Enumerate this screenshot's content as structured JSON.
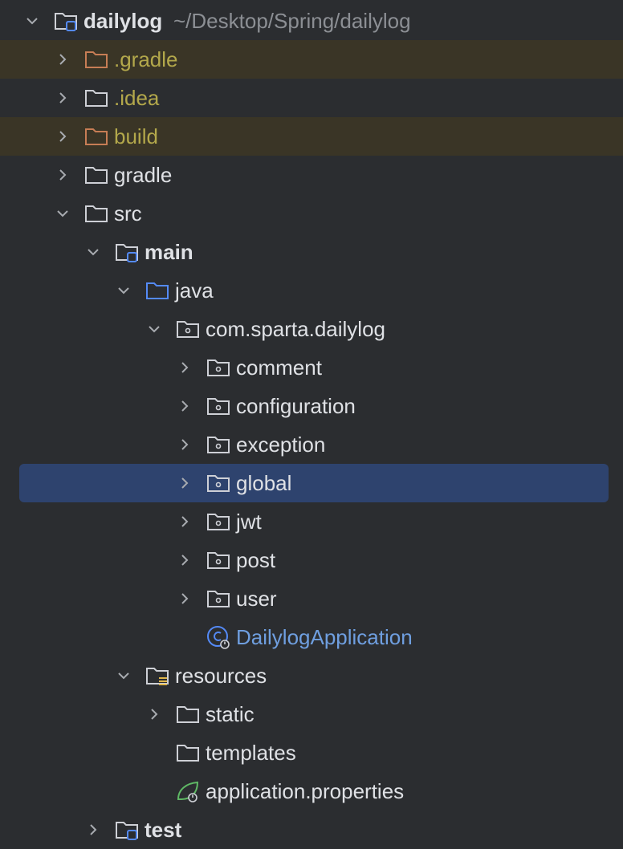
{
  "project_tree": {
    "root": {
      "label": "dailylog",
      "path": "~/Desktop/Spring/dailylog"
    },
    "items": [
      {
        "label": ".gradle",
        "icon": "folder-excluded-icon"
      },
      {
        "label": ".idea",
        "icon": "folder-icon"
      },
      {
        "label": "build",
        "icon": "folder-excluded-icon"
      },
      {
        "label": "gradle",
        "icon": "folder-icon"
      },
      {
        "label": "src",
        "icon": "folder-icon"
      },
      {
        "label": "main",
        "icon": "module-folder-icon"
      },
      {
        "label": "java",
        "icon": "source-folder-icon"
      },
      {
        "label": "com.sparta.dailylog",
        "icon": "package-icon"
      },
      {
        "label": "comment",
        "icon": "package-icon"
      },
      {
        "label": "configuration",
        "icon": "package-icon"
      },
      {
        "label": "exception",
        "icon": "package-icon"
      },
      {
        "label": "global",
        "icon": "package-icon"
      },
      {
        "label": "jwt",
        "icon": "package-icon"
      },
      {
        "label": "post",
        "icon": "package-icon"
      },
      {
        "label": "user",
        "icon": "package-icon"
      },
      {
        "label": "DailylogApplication",
        "icon": "spring-boot-class-icon"
      },
      {
        "label": "resources",
        "icon": "resources-folder-icon"
      },
      {
        "label": "static",
        "icon": "folder-icon"
      },
      {
        "label": "templates",
        "icon": "folder-icon"
      },
      {
        "label": "application.properties",
        "icon": "spring-properties-icon"
      },
      {
        "label": "test",
        "icon": "module-folder-icon"
      }
    ]
  },
  "colors": {
    "background": "#2b2d30",
    "selection": "#2e436e",
    "excluded_row": "#3a3526",
    "excluded_text": "#b3a84b",
    "class_text": "#6f9fe0",
    "path_text": "#8c8f94"
  }
}
